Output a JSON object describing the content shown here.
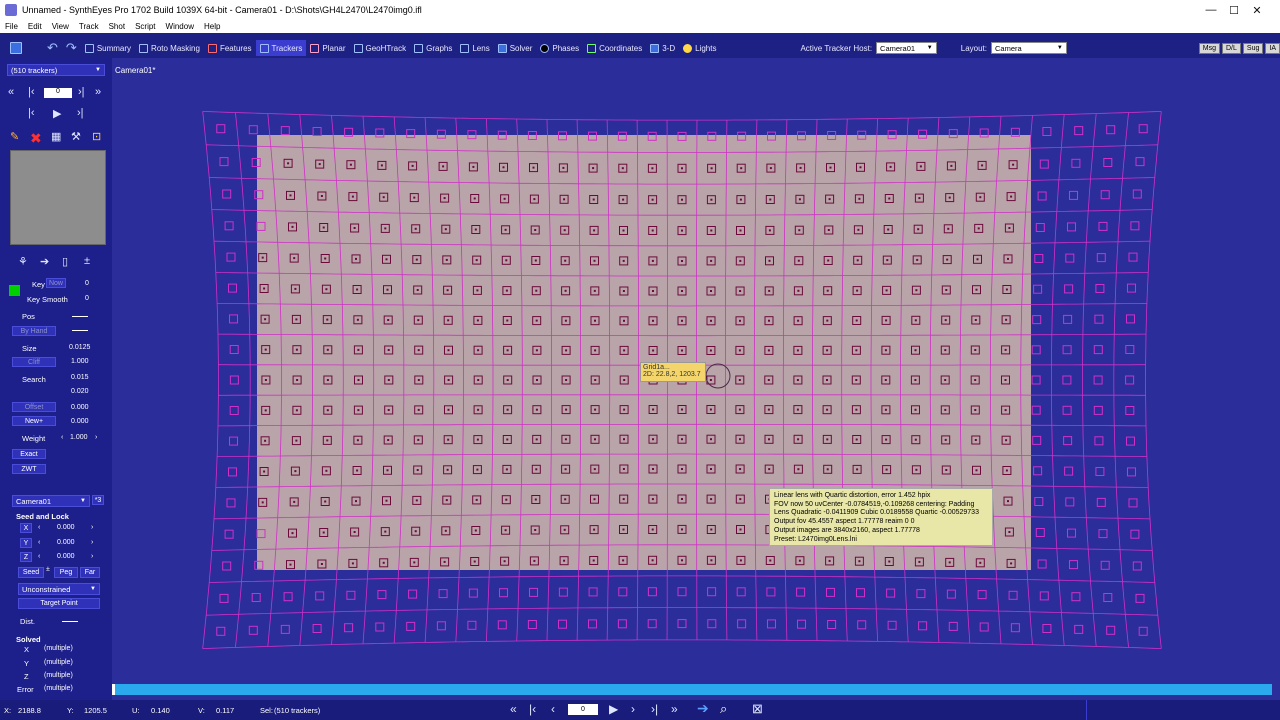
{
  "titlebar": {
    "title": "Unnamed - SynthEyes Pro 1702 Build 1039X 64-bit - Camera01 - D:\\Shots\\GH4L2470\\L2470img0.ifl",
    "minimize": "—",
    "maximize": "☐",
    "close": "✕"
  },
  "menu": [
    "File",
    "Edit",
    "View",
    "Track",
    "Shot",
    "Script",
    "Window",
    "Help"
  ],
  "toolbar": {
    "tabs": [
      "Summary",
      "Roto Masking",
      "Features",
      "Trackers",
      "Planar",
      "GeoHTrack",
      "Graphs",
      "Lens",
      "Solver",
      "Phases",
      "Coordinates",
      "3-D",
      "Lights"
    ],
    "active_tab": "Trackers",
    "tracker_host_label": "Active Tracker Host:",
    "tracker_host_value": "Camera01",
    "layout_label": "Layout:",
    "layout_value": "Camera",
    "right_buttons": [
      "Msg",
      "D/L",
      "Sug",
      "IA"
    ]
  },
  "leftpanel": {
    "tracker_select": "(510 trackers)",
    "frame_value": "0",
    "key_label": "Key",
    "key_now": "Now",
    "key_value": "0",
    "key_smooth_label": "Key Smooth",
    "key_smooth_value": "0",
    "pos_label": "Pos",
    "by_hand_label": "By Hand",
    "size_label": "Size",
    "size_value": "0.0125",
    "cliff_label": "Cliff",
    "cliff_value": "1.000",
    "search_label": "Search",
    "search_value1": "0.015",
    "search_value2": "0.020",
    "offset_label": "Offset",
    "offset_value": "0.000",
    "new_label": "New+",
    "new_value": "0.000",
    "weight_label": "Weight",
    "weight_value": "1.000",
    "exact_label": "Exact",
    "zwt_label": "ZWT",
    "camera_select": "Camera01",
    "camera_btn": "*3",
    "seed_lock_title": "Seed and Lock",
    "x_label": "X",
    "x_value": "0.000",
    "y_label": "Y",
    "y_value": "0.000",
    "z_label": "Z",
    "z_value": "0.000",
    "seed_btn": "Seed",
    "peg_btn": "Peg",
    "far_btn": "Far",
    "constraint_select": "Unconstrained",
    "target_point_btn": "Target Point",
    "dist_label": "Dist.",
    "solved_title": "Solved",
    "solved_x_label": "X",
    "solved_x": "(multiple)",
    "solved_y_label": "Y",
    "solved_y": "(multiple)",
    "solved_z_label": "Z",
    "solved_z": "(multiple)",
    "error_label": "Error",
    "error_value": "(multiple)"
  },
  "viewport": {
    "camera_label": "Camera01*",
    "tooltip_name": "Grid1a...",
    "tooltip_coords": "2D: 22.8,2, 1203.7",
    "info_lines": [
      "Linear lens with Quartic distortion, error 1.452 hpix",
      "FOV now 50 uvCenter -0.0784519,-0.109268 centering: Padding",
      "Lens Quadratic -0.0411909 Cubic 0.0189558 Quartic -0.00529733",
      "Output fov 45.4557 aspect 1.77778 reaim 0 0",
      "Output images are 3840x2160, aspect 1.77778",
      "Preset: L2470img0Lens.lni"
    ]
  },
  "statusbar": {
    "x_label": "X:",
    "x_value": "2188.8",
    "y_label": "Y:",
    "y_value": "1205.5",
    "u_label": "U:",
    "u_value": "0.140",
    "v_label": "V:",
    "v_value": "0.117",
    "sel_label": "Sel:",
    "sel_value": "(510 trackers)",
    "frame_value": "0"
  },
  "colors": {
    "background": "#2b2e9a",
    "grid": "#d030c8",
    "marker": "#6b0a3a",
    "image": "#b9a4a9",
    "accent": "#2aa9ef"
  }
}
